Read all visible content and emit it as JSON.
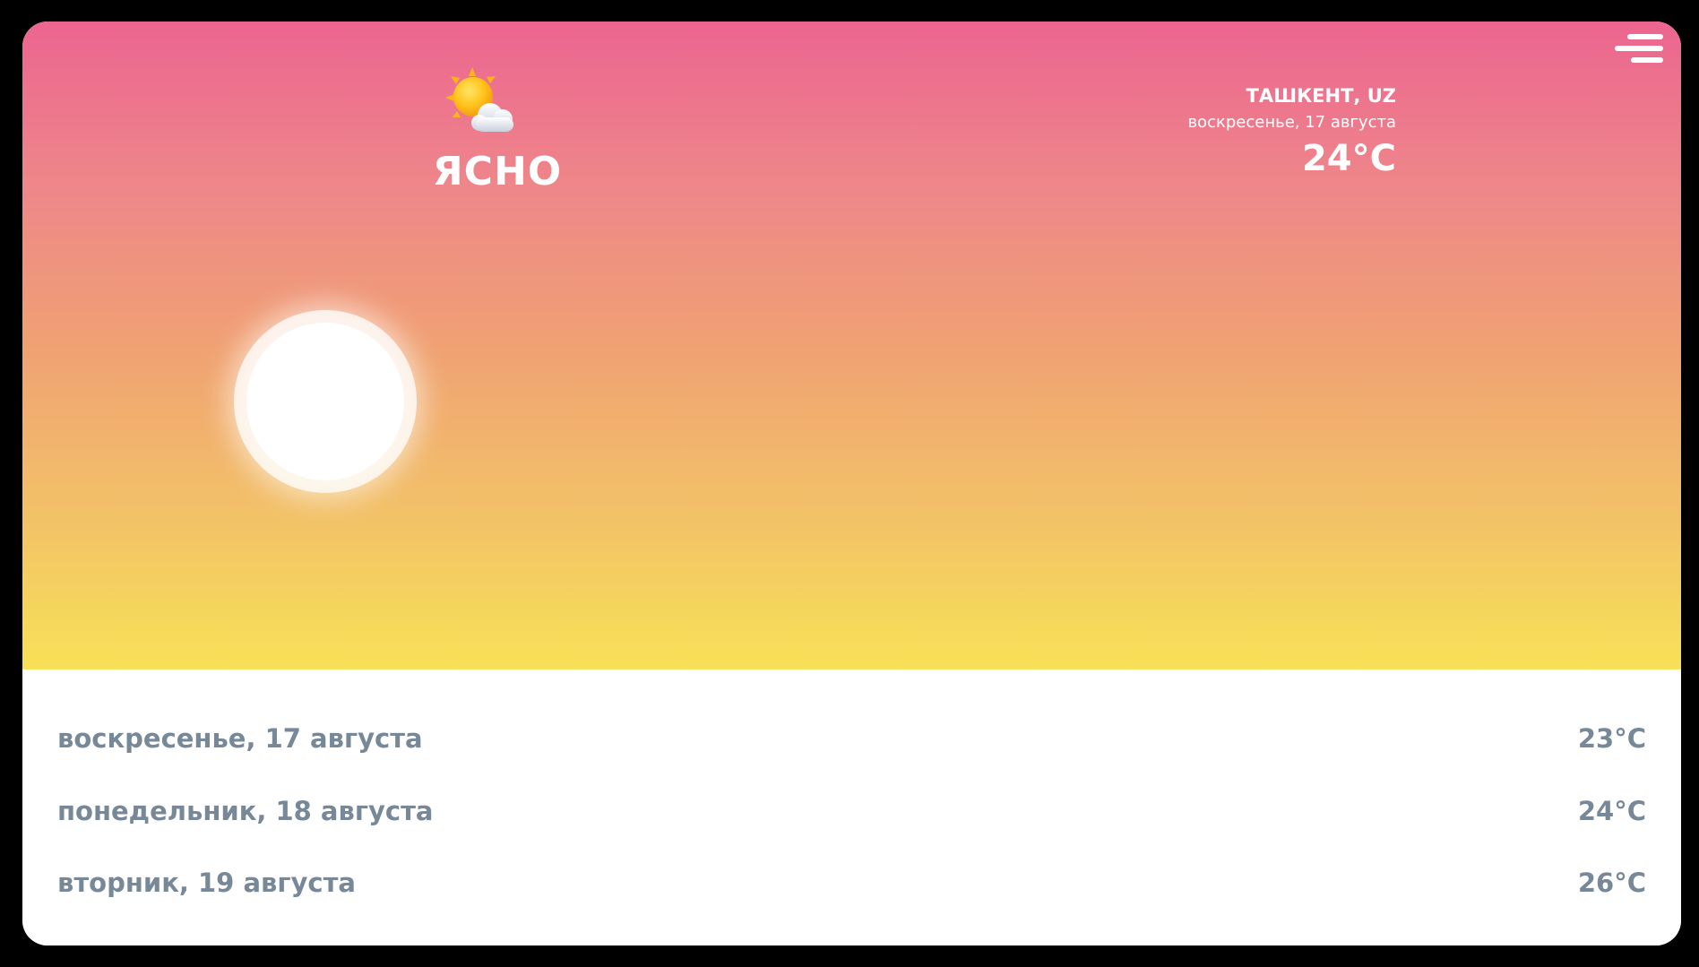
{
  "current": {
    "icon": "sun-behind-cloud-icon",
    "condition": "ЯСНО",
    "location": "ТАШКЕНТ, UZ",
    "date": "воскресенье, 17 августа",
    "temperature": "24°C"
  },
  "menu": {
    "icon": "hamburger-menu-icon"
  },
  "sky": {
    "icon": "sun-icon"
  },
  "forecast": [
    {
      "day": "воскресенье, 17 августа",
      "temp": "23°C"
    },
    {
      "day": "понедельник, 18 августа",
      "temp": "24°C"
    },
    {
      "day": "вторник, 19 августа",
      "temp": "26°C"
    }
  ],
  "colors": {
    "gradient_top": "#ec6590",
    "gradient_bottom": "#f7e157",
    "forecast_text": "#778899"
  }
}
